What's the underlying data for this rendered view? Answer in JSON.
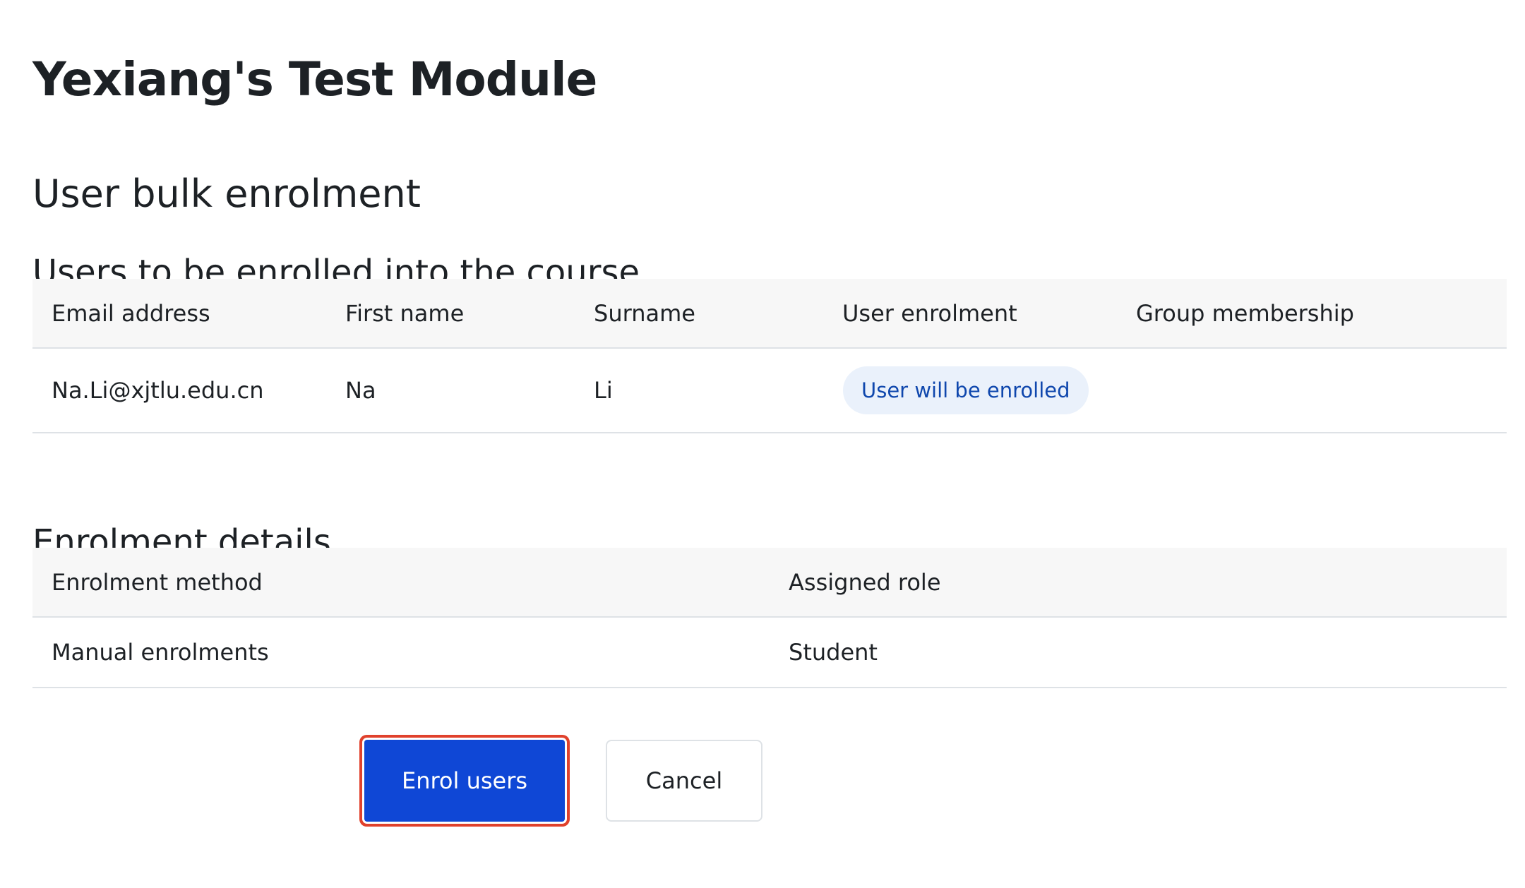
{
  "course": {
    "title": "Yexiang's Test Module"
  },
  "page": {
    "heading": "User bulk enrolment"
  },
  "users_section": {
    "heading": "Users to be enrolled into the course",
    "columns": [
      "Email address",
      "First name",
      "Surname",
      "User enrolment",
      "Group membership"
    ],
    "rows": [
      {
        "email": "Na.Li@xjtlu.edu.cn",
        "first_name": "Na",
        "surname": "Li",
        "enrolment_status": "User will be enrolled",
        "group_membership": ""
      }
    ]
  },
  "details_section": {
    "heading": "Enrolment details",
    "columns": [
      "Enrolment method",
      "Assigned role"
    ],
    "rows": [
      {
        "method": "Manual enrolments",
        "role": "Student"
      }
    ]
  },
  "actions": {
    "enrol_label": "Enrol users",
    "cancel_label": "Cancel"
  },
  "colors": {
    "primary": "#0f47d6",
    "badge_bg": "#eaf1fb",
    "badge_text": "#0f47ad",
    "highlight": "#e0412c"
  }
}
